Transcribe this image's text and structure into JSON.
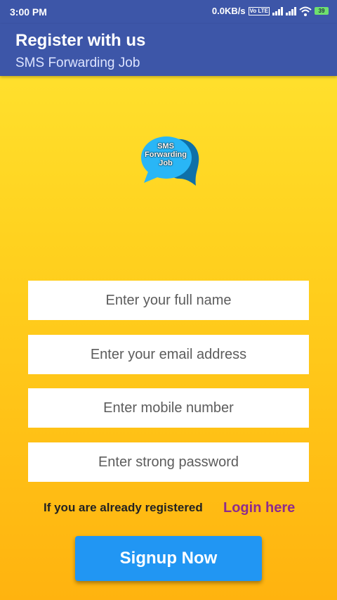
{
  "status_bar": {
    "time": "3:00 PM",
    "network_speed": "0.0KB/s",
    "volte": "Vo LTE",
    "battery": "39"
  },
  "app_bar": {
    "title": "Register with us",
    "subtitle": "SMS Forwarding Job"
  },
  "logo": {
    "lines": [
      "SMS",
      "Forwarding",
      "Job"
    ],
    "color": "#29B6F6"
  },
  "form": {
    "name_placeholder": "Enter your full name",
    "email_placeholder": "Enter your email address",
    "mobile_placeholder": "Enter mobile number",
    "password_placeholder": "Enter strong password"
  },
  "login_prompt": {
    "text": "If you are already registered",
    "link": "Login here"
  },
  "signup_button": "Signup Now"
}
